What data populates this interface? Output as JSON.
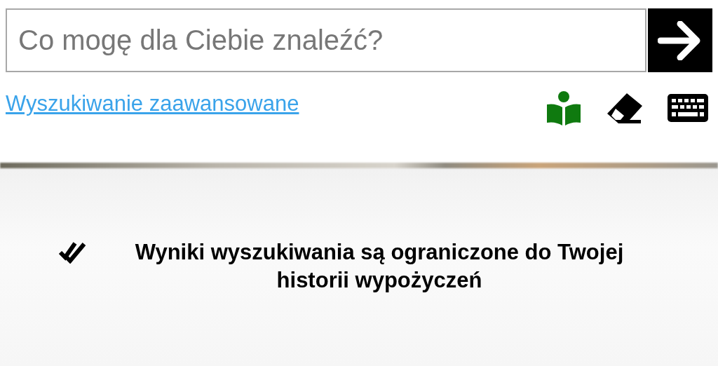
{
  "search": {
    "placeholder": "Co mogę dla Ciebie znaleźć?"
  },
  "advanced_search_link": "Wyszukiwanie zaawansowane",
  "notice": {
    "text": "Wyniki wyszukiwania są ograniczone do Twojej historii wypożyczeń"
  }
}
